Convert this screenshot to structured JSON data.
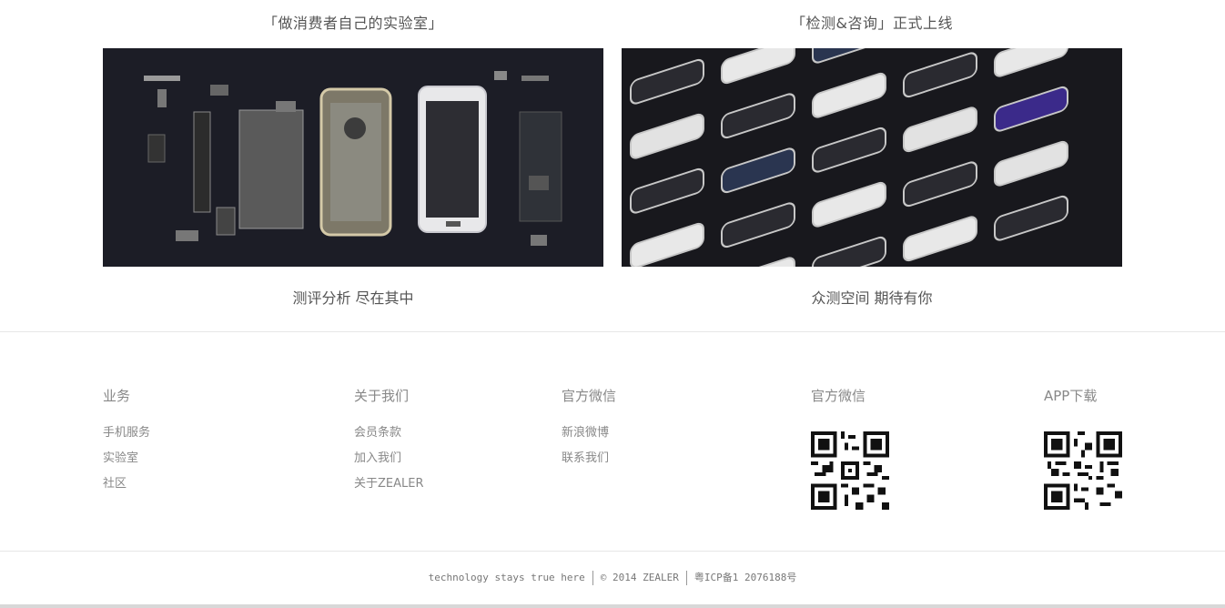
{
  "promos": [
    {
      "top_caption": "「做消费者自己的实验室」",
      "bottom_caption": "测评分析 尽在其中"
    },
    {
      "top_caption": "「检测&咨询」正式上线",
      "bottom_caption": "众测空间 期待有你"
    }
  ],
  "footer": {
    "business": {
      "title": "业务",
      "links": [
        "手机服务",
        "实验室",
        "社区"
      ]
    },
    "about": {
      "title": "关于我们",
      "links": [
        "会员条款",
        "加入我们",
        "关于ZEALER"
      ]
    },
    "social": {
      "title": "官方微信",
      "links": [
        "新浪微博",
        "联系我们"
      ]
    },
    "wechat_qr": {
      "title": "官方微信",
      "icon": "qr-code-icon"
    },
    "app_qr": {
      "title": "APP下载",
      "icon": "qr-code-icon"
    }
  },
  "bottom_bar": {
    "slogan": "technology stays true here",
    "copyright": "© 2014 ZEALER",
    "icp": "粤ICP备1 2076188号"
  }
}
